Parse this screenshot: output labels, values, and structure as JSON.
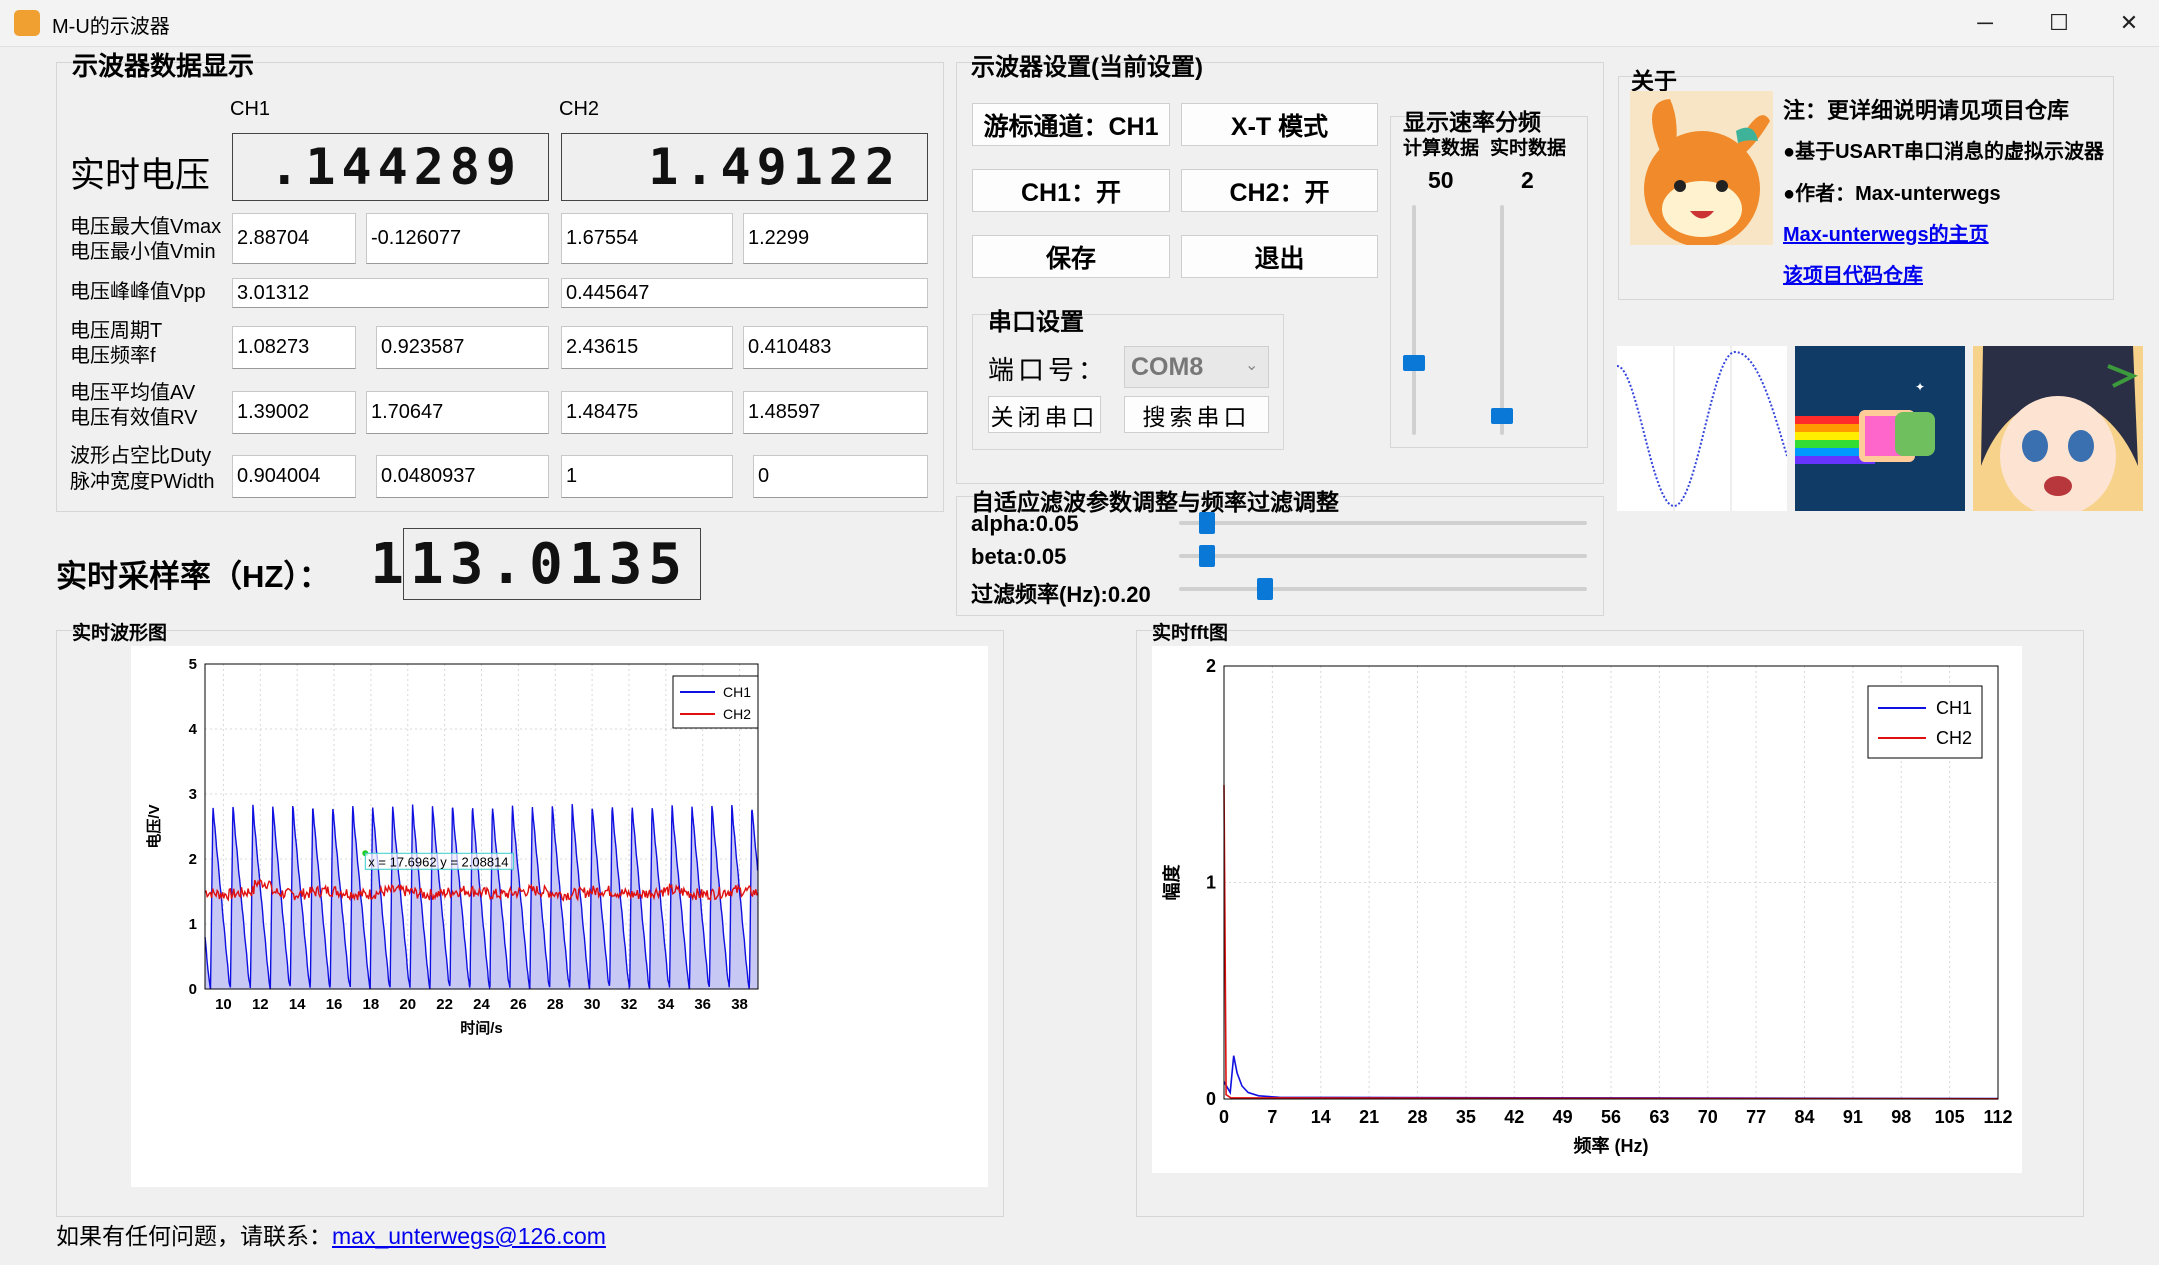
{
  "window": {
    "title": "M-U的示波器",
    "minimize_glyph": "─",
    "maximize_glyph": "☐",
    "close_glyph": "✕"
  },
  "data_display": {
    "heading": "示波器数据显示",
    "ch1_label": "CH1",
    "ch2_label": "CH2",
    "realtime_voltage_label": "实时电压",
    "ch1_voltage": ".144289",
    "ch2_voltage": "1.49122",
    "rows": [
      {
        "label1": "电压最大值Vmax",
        "label2": "电压最小值Vmin",
        "values": [
          "2.88704",
          "-0.126077",
          "1.67554",
          "1.2299"
        ]
      },
      {
        "label1": "电压峰峰值Vpp",
        "label2": "",
        "values": [
          "3.01312",
          "0.445647"
        ]
      },
      {
        "label1": "电压周期T",
        "label2": "电压频率f",
        "values": [
          "1.08273",
          "0.923587",
          "2.43615",
          "0.410483"
        ]
      },
      {
        "label1": "电压平均值AV",
        "label2": "电压有效值RV",
        "values": [
          "1.39002",
          "1.70647",
          "1.48475",
          "1.48597"
        ]
      },
      {
        "label1": "波形占空比Duty",
        "label2": "脉冲宽度PWidth",
        "values": [
          "0.904004",
          "0.0480937",
          "1",
          "0"
        ]
      }
    ],
    "sample_rate_label": "实时采样率（HZ）：",
    "sample_rate_value": "113.0135"
  },
  "settings": {
    "heading": "示波器设置(当前设置)",
    "cursor_channel_btn": "游标通道：CH1",
    "mode_btn": "X-T 模式",
    "ch1_btn": "CH1：开",
    "ch2_btn": "CH2：开",
    "save_btn": "保存",
    "exit_btn": "退出",
    "serial_heading": "串口设置",
    "port_label": "端口号：",
    "port_value": "COM8",
    "close_port_btn": "关闭串口",
    "search_port_btn": "搜索串口",
    "rate_heading": "显示速率分频",
    "calc_label": "计算数据",
    "realtime_label": "实时数据",
    "calc_value": "50",
    "realtime_value": "2",
    "calc_slider_fraction": 0.3,
    "realtime_slider_fraction": 0.05
  },
  "filter": {
    "heading": "自适应滤波参数调整与频率过滤调整",
    "alpha_label": "alpha:0.05",
    "beta_label": "beta:0.05",
    "freq_label": "过滤频率(Hz):0.20",
    "alpha_fraction": 0.05,
    "beta_fraction": 0.05,
    "freq_fraction": 0.2
  },
  "about": {
    "heading": "关于",
    "note": "注：更详细说明请见项目仓库",
    "bullet1": "●基于USART串口消息的虚拟示波器",
    "bullet2": "●作者：Max-unterwegs",
    "link1": "Max-unterwegs的主页",
    "link2": "该项目代码仓库"
  },
  "footer": {
    "text": "如果有任何问题，请联系：",
    "email": "max_unterwegs@126.com"
  },
  "waveform_panel": {
    "heading": "实时波形图",
    "cursor_readout": "x = 17.6962  y = 2.08814"
  },
  "fft_panel": {
    "heading": "实时fft图"
  },
  "colors": {
    "ch1": "#1010e0",
    "ch2": "#e01010",
    "ch1_fill": "#c8c8f4",
    "accent": "#0a78d7"
  },
  "chart_data": [
    {
      "type": "line",
      "title": "",
      "xlabel": "时间/s",
      "ylabel": "电压/V",
      "xlim": [
        9,
        39
      ],
      "ylim": [
        0,
        5
      ],
      "x_ticks": [
        "10",
        "12",
        "14",
        "16",
        "18",
        "20",
        "22",
        "24",
        "26",
        "28",
        "30",
        "32",
        "34",
        "36",
        "38"
      ],
      "y_ticks": [
        "0",
        "1",
        "2",
        "3",
        "4",
        "5"
      ],
      "grid": true,
      "legend": "top-right",
      "series": [
        {
          "name": "CH1",
          "description_values": {
            "shape": "sawtooth",
            "period": 1.08273,
            "min": 0.0,
            "max": 2.88704
          }
        },
        {
          "name": "CH2",
          "description_values": {
            "shape": "noisy",
            "mean": 1.48475,
            "min": 1.2299,
            "max": 1.67554
          }
        }
      ]
    },
    {
      "type": "line",
      "title": "",
      "xlabel": "频率 (Hz)",
      "ylabel": "幅度",
      "xlim": [
        0,
        112
      ],
      "ylim": [
        0,
        2
      ],
      "x_ticks": [
        "0",
        "7",
        "14",
        "21",
        "28",
        "35",
        "42",
        "49",
        "56",
        "63",
        "70",
        "77",
        "84",
        "91",
        "98",
        "105",
        "112"
      ],
      "y_ticks": [
        "0",
        "1",
        "2"
      ],
      "grid": true,
      "legend": "top-right",
      "series": [
        {
          "name": "CH1",
          "points": [
            [
              0,
              0.08
            ],
            [
              0.9,
              0.03
            ],
            [
              1.4,
              0.2
            ],
            [
              1.9,
              0.12
            ],
            [
              2.6,
              0.06
            ],
            [
              3.5,
              0.03
            ],
            [
              5,
              0.015
            ],
            [
              8,
              0.008
            ],
            [
              112,
              0.002
            ]
          ]
        },
        {
          "name": "CH2",
          "points": [
            [
              0,
              1.45
            ],
            [
              0.3,
              0.02
            ],
            [
              1,
              0.005
            ],
            [
              112,
              0.001
            ]
          ]
        }
      ]
    }
  ]
}
